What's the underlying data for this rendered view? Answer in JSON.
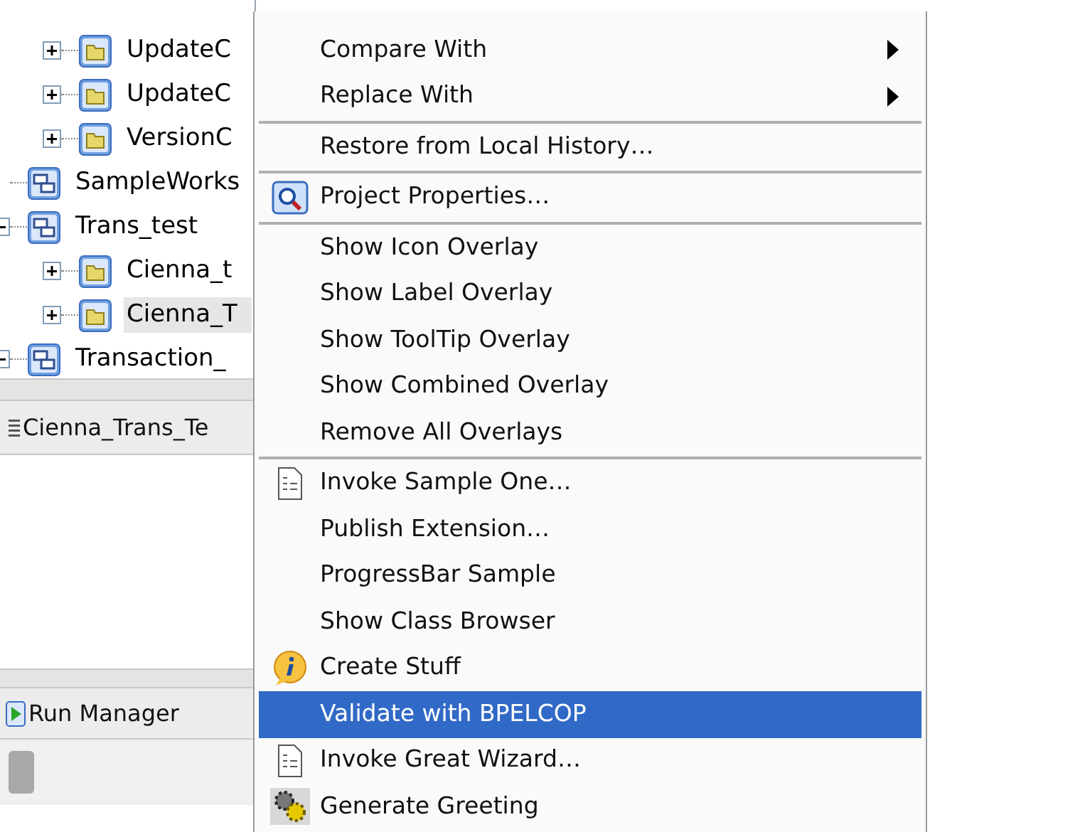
{
  "tree": {
    "upper_branch_items": [
      {
        "label": "UpdateC",
        "expanded": false
      },
      {
        "label": "UpdateC",
        "expanded": false
      },
      {
        "label": "VersionC",
        "expanded": false
      }
    ],
    "items": [
      {
        "label": "SampleWorks",
        "kind": "project",
        "selected": false
      },
      {
        "label": "Trans_test",
        "kind": "project",
        "expanded": true,
        "selected": false,
        "children": [
          {
            "label": "Cienna_t",
            "kind": "folder",
            "expanded": false,
            "selected": false
          },
          {
            "label": "Cienna_T",
            "kind": "folder",
            "expanded": false,
            "selected": true
          }
        ]
      },
      {
        "label": "Transaction_",
        "kind": "project",
        "expanded": true,
        "selected": false
      }
    ]
  },
  "editor_tab": {
    "label": "Cienna_Trans_Te"
  },
  "run_manager_tab": {
    "label": "Run Manager"
  },
  "context_menu": {
    "items": [
      {
        "kind": "submenu",
        "label": "Compare With",
        "selected": false
      },
      {
        "kind": "submenu",
        "label": "Replace With",
        "selected": false
      },
      {
        "kind": "separator"
      },
      {
        "kind": "plain",
        "label": "Restore from Local History…",
        "selected": false
      },
      {
        "kind": "separator"
      },
      {
        "kind": "properties",
        "label": "Project Properties…",
        "selected": false
      },
      {
        "kind": "separator"
      },
      {
        "kind": "plain",
        "label": "Show Icon Overlay",
        "selected": false
      },
      {
        "kind": "plain",
        "label": "Show Label Overlay",
        "selected": false
      },
      {
        "kind": "plain",
        "label": "Show ToolTip Overlay",
        "selected": false
      },
      {
        "kind": "plain",
        "label": "Show Combined Overlay",
        "selected": false
      },
      {
        "kind": "plain",
        "label": "Remove All Overlays",
        "selected": false
      },
      {
        "kind": "separator"
      },
      {
        "kind": "document",
        "label": "Invoke Sample One…",
        "selected": false
      },
      {
        "kind": "plain",
        "label": "Publish Extension…",
        "selected": false
      },
      {
        "kind": "plain",
        "label": "ProgressBar Sample",
        "selected": false
      },
      {
        "kind": "plain",
        "label": "Show Class Browser",
        "selected": false
      },
      {
        "kind": "info",
        "label": "Create Stuff",
        "selected": false
      },
      {
        "kind": "plain",
        "label": "Validate with BPELCOP",
        "selected": true
      },
      {
        "kind": "document",
        "label": "Invoke Great Wizard…",
        "selected": false
      },
      {
        "kind": "gears",
        "label": "Generate Greeting",
        "selected": false
      }
    ]
  }
}
